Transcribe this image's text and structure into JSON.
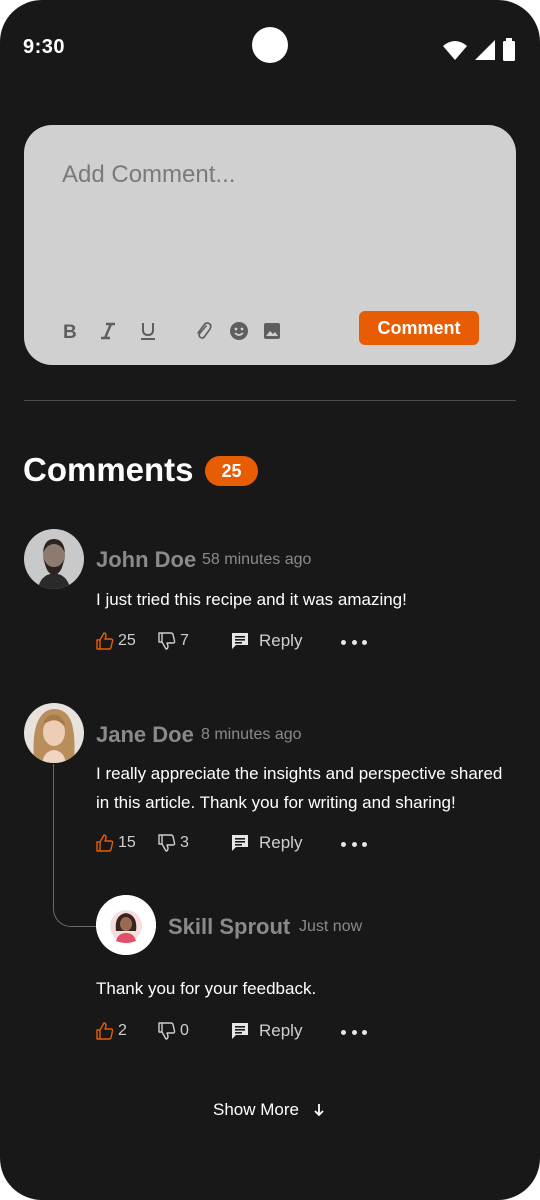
{
  "status_bar": {
    "time": "9:30"
  },
  "composer": {
    "placeholder": "Add Comment...",
    "submit_label": "Comment",
    "tools": [
      "bold-icon",
      "italic-icon",
      "underline-icon",
      "attachment-icon",
      "emoji-icon",
      "image-icon"
    ]
  },
  "comments_section": {
    "title": "Comments",
    "count": "25"
  },
  "comments": [
    {
      "author": "John Doe",
      "time": "58 minutes ago",
      "text": "I just tried this recipe and it was amazing!",
      "likes": "25",
      "dislikes": "7",
      "reply_label": "Reply"
    },
    {
      "author": "Jane Doe",
      "time": "8 minutes ago",
      "text": "I really appreciate the insights and perspective shared in this article. Thank you for writing and sharing!",
      "likes": "15",
      "dislikes": "3",
      "reply_label": "Reply"
    }
  ],
  "reply": {
    "author": "Skill Sprout",
    "time": "Just now",
    "text": "Thank you for your feedback.",
    "likes": "2",
    "dislikes": "0",
    "reply_label": "Reply"
  },
  "show_more": {
    "label": "Show More"
  },
  "colors": {
    "accent": "#e85d04",
    "background": "#181818",
    "composer_bg": "#d0d0d0",
    "muted_text": "#8a8a8a"
  }
}
